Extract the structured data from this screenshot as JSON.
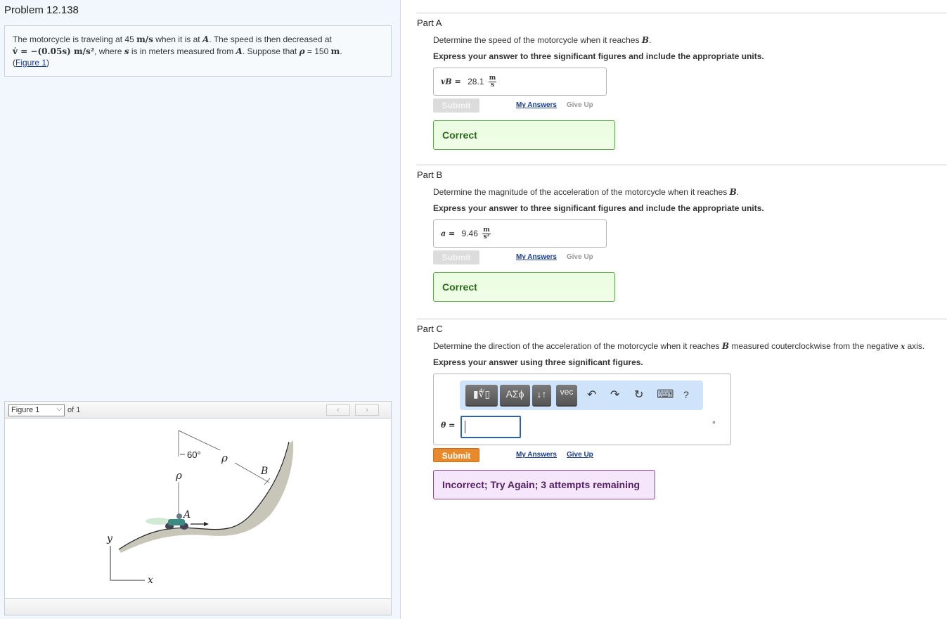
{
  "problem": {
    "title": "Problem 12.138",
    "intro": {
      "line1_a": "The motorcycle is traveling at 45 ",
      "unit_ms": "m/s",
      "line1_b": " when it is at ",
      "point_A": "A",
      "line1_c": ". The speed is then decreased at",
      "accel_expr": "v̇ = −(0.05s) m/s²",
      "line2_b": ", where ",
      "var_s": "s",
      "line2_c": " is in meters measured from ",
      "line2_d": ". Suppose that ",
      "rho_sym": "ρ",
      "line2_e": " = 150 ",
      "unit_m": "m",
      "line2_f": ".",
      "fig_link_open": "(",
      "fig_link": "Figure 1",
      "fig_link_close": ")"
    }
  },
  "figure": {
    "selector_value": "Figure 1",
    "of_label": "of 1",
    "prev_icon": "‹",
    "next_icon": "›",
    "labels": {
      "angle": "60°",
      "rho1": "ρ",
      "rho2": "ρ",
      "point_B": "B",
      "point_A": "A",
      "axis_y": "y",
      "axis_x": "x"
    }
  },
  "parts": [
    {
      "title": "Part A",
      "question_a": "Determine the speed of the motorcycle when it reaches ",
      "question_var": "B",
      "question_b": ".",
      "instruction": "Express your answer to three significant figures and include the appropriate units.",
      "answer_label": "vB =",
      "answer_value": "28.1",
      "unit_num": "m",
      "unit_den": "s",
      "submit_label": "Submit",
      "my_answers_label": "My Answers",
      "give_up_label": "Give Up",
      "feedback": "Correct"
    },
    {
      "title": "Part B",
      "question_a": "Determine the magnitude of the acceleration of the motorcycle when it reaches ",
      "question_var": "B",
      "question_b": ".",
      "instruction": "Express your answer to three significant figures and include the appropriate units.",
      "answer_label": "a =",
      "answer_value": "9.46",
      "unit_num": "m",
      "unit_den": "s²",
      "submit_label": "Submit",
      "my_answers_label": "My Answers",
      "give_up_label": "Give Up",
      "feedback": "Correct"
    },
    {
      "title": "Part C",
      "question_a": "Determine the direction of the acceleration of the motorcycle when it reaches ",
      "question_var": "B",
      "question_b": " measured couterclockwise from the negative ",
      "question_var2": "x",
      "question_c": " axis.",
      "instruction": "Express your answer using three significant figures.",
      "answer_label": "θ =",
      "answer_value": "",
      "unit": "°",
      "toolbar": {
        "templates": "▮∜▯",
        "greek": "ΑΣϕ",
        "arrows": "↓↑",
        "vec": "vec",
        "undo": "↶",
        "redo": "↷",
        "reset": "↻",
        "keyboard": "⌨",
        "help": "?"
      },
      "submit_label": "Submit",
      "my_answers_label": "My Answers",
      "give_up_label": "Give Up",
      "feedback": "Incorrect; Try Again; 3 attempts remaining"
    }
  ]
}
